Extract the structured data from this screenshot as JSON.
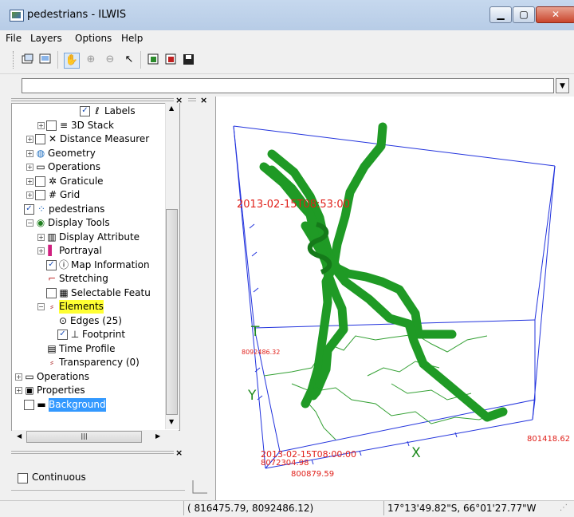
{
  "window": {
    "title": "pedestrians - ILWIS",
    "controls": [
      "minimize-icon",
      "maximize-icon",
      "close-icon"
    ]
  },
  "menu": [
    "File",
    "Layers",
    "Options",
    "Help"
  ],
  "toolbar": {
    "icons": [
      "new-window-icon",
      "open-map-icon",
      "pan-hand-icon",
      "zoom-in-icon",
      "zoom-out-icon",
      "select-pointer-icon",
      "add-layer-icon",
      "remove-layer-icon",
      "save-icon"
    ]
  },
  "command_line": {
    "value": ""
  },
  "tree": [
    {
      "label": "Labels",
      "indent": 5,
      "checked": true,
      "expander": ""
    },
    {
      "label": "3D Stack",
      "indent": 2,
      "checked": false,
      "expander": "+"
    },
    {
      "label": "Distance Measurer",
      "indent": 1,
      "checked": false,
      "expander": "+"
    },
    {
      "label": "Geometry",
      "indent": 1,
      "checked": null,
      "expander": "+"
    },
    {
      "label": "Operations",
      "indent": 1,
      "checked": null,
      "expander": "+"
    },
    {
      "label": "Graticule",
      "indent": 1,
      "checked": false,
      "expander": "+"
    },
    {
      "label": "Grid",
      "indent": 1,
      "checked": false,
      "expander": "+"
    },
    {
      "label": "pedestrians",
      "indent": 0,
      "checked": true,
      "expander": ""
    },
    {
      "label": "Display Tools",
      "indent": 1,
      "checked": null,
      "expander": "-"
    },
    {
      "label": "Display Attribute",
      "indent": 2,
      "checked": null,
      "expander": "+"
    },
    {
      "label": "Portrayal",
      "indent": 2,
      "checked": null,
      "expander": "+"
    },
    {
      "label": "Map Information",
      "indent": 2,
      "checked": true,
      "expander": ""
    },
    {
      "label": "Stretching",
      "indent": 2,
      "checked": null,
      "expander": ""
    },
    {
      "label": "Selectable Featu",
      "indent": 2,
      "checked": false,
      "expander": ""
    },
    {
      "label": "Elements",
      "indent": 2,
      "checked": null,
      "expander": "-",
      "highlight": true
    },
    {
      "label": "Edges (25)",
      "indent": 3,
      "checked": null,
      "expander": ""
    },
    {
      "label": "Footprint",
      "indent": 3,
      "checked": true,
      "expander": ""
    },
    {
      "label": "Time Profile",
      "indent": 2,
      "checked": null,
      "expander": ""
    },
    {
      "label": "Transparency (0)",
      "indent": 2,
      "checked": null,
      "expander": ""
    },
    {
      "label": "Operations",
      "indent": 0,
      "checked": null,
      "expander": "+"
    },
    {
      "label": "Properties",
      "indent": 0,
      "checked": null,
      "expander": "+"
    },
    {
      "label": "Background",
      "indent": 0,
      "checked": false,
      "expander": "",
      "selected": true
    }
  ],
  "tree_icons": [
    "labels-icon",
    "stack-icon",
    "distance-measurer-icon",
    "globe-icon",
    "operations-icon",
    "graticule-icon",
    "grid-icon",
    "point-map-icon",
    "display-tools-icon",
    "display-attribute-icon",
    "portrayal-icon",
    "map-info-icon",
    "stretch-icon",
    "selectable-features-icon",
    "elements-icon",
    "edges-icon",
    "footprint-icon",
    "time-profile-icon",
    "transparency-icon",
    "operations-icon",
    "properties-icon",
    "background-icon"
  ],
  "panel2": {
    "option": "Continuous",
    "checked": false
  },
  "map": {
    "time_label_top": "2013-02-15T08:53:00",
    "time_label_bottom": "2013-02-15T08:00:00",
    "y_value": "8092486.32",
    "y_min": "8072304.98",
    "x_min": "800879.59",
    "x_max": "801418.62",
    "axis_t": "T",
    "axis_y": "Y",
    "axis_x": "X"
  },
  "status": {
    "coordinates": "( 816475.79, 8092486.12)",
    "latlon": "17°13'49.82\"S, 66°01'27.77\"W"
  },
  "colors": {
    "path": "#22a82a",
    "box": "#2233dd",
    "label": "#e0201a",
    "footprint": "#33a033",
    "highlight": "#ffff33",
    "selection": "#3399ff"
  }
}
